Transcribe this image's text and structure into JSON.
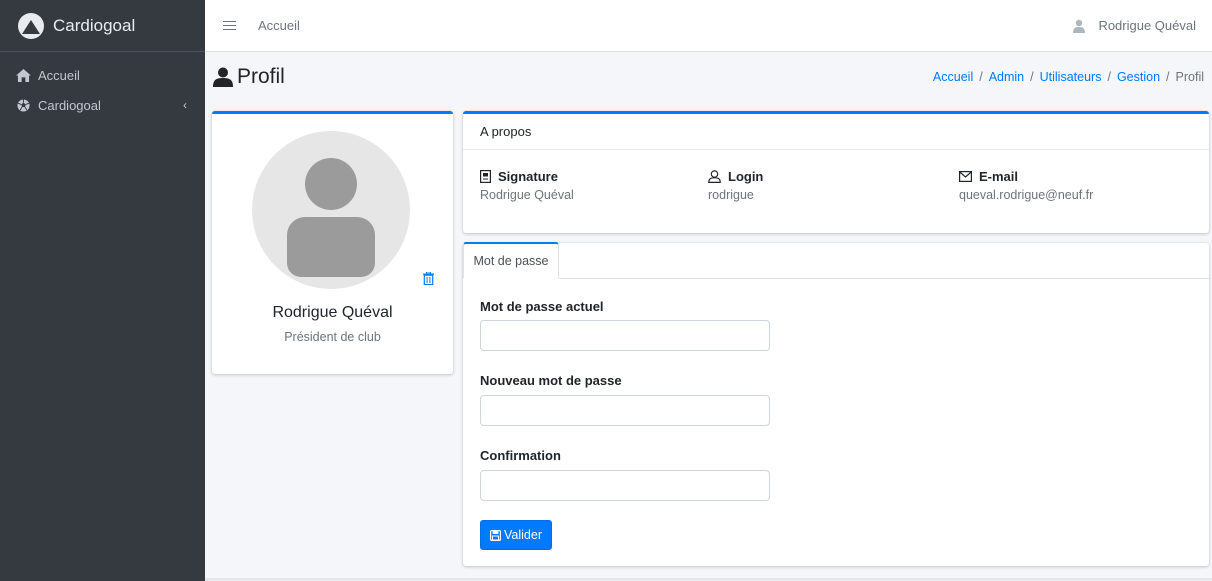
{
  "sidebar": {
    "brand": "Cardiogoal",
    "items": [
      {
        "label": "Accueil",
        "icon": "home-icon"
      },
      {
        "label": "Cardiogoal",
        "icon": "soccer-ball-icon",
        "caret": "‹"
      }
    ]
  },
  "topbar": {
    "home_link": "Accueil",
    "user_name": "Rodrigue Quéval"
  },
  "header": {
    "title": "Profil",
    "breadcrumb": [
      "Accueil",
      "Admin",
      "Utilisateurs",
      "Gestion"
    ],
    "breadcrumb_current": "Profil",
    "breadcrumb_sep": "/"
  },
  "profile": {
    "name": "Rodrigue Quéval",
    "role": "Président de club"
  },
  "about": {
    "title": "A propos",
    "signature_label": "Signature",
    "signature_value": "Rodrigue Quéval",
    "login_label": "Login",
    "login_value": "rodrigue",
    "email_label": "E-mail",
    "email_value": "queval.rodrigue@neuf.fr"
  },
  "password": {
    "tab": "Mot de passe",
    "current_label": "Mot de passe actuel",
    "current_value": "",
    "new_label": "Nouveau mot de passe",
    "new_value": "",
    "confirm_label": "Confirmation",
    "confirm_value": "",
    "submit": "Valider"
  },
  "colors": {
    "primary": "#007bff",
    "sidebar_bg": "#343a40",
    "content_bg": "#f4f6f9"
  }
}
